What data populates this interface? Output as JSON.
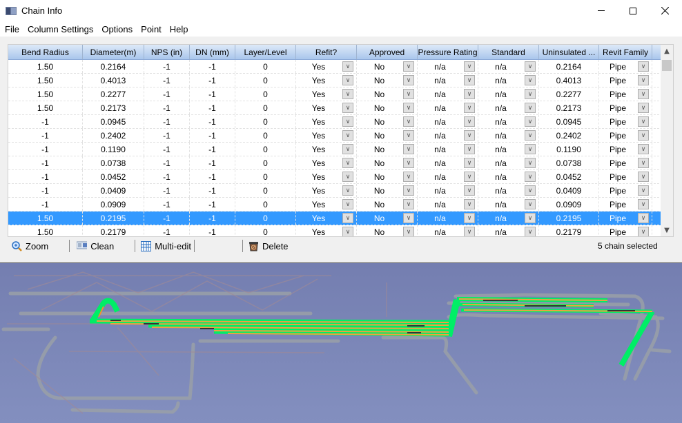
{
  "window": {
    "title": "Chain Info",
    "icon": "app-icon",
    "controls": [
      "minimize-icon",
      "maximize-icon",
      "close-icon"
    ]
  },
  "menu": [
    "File",
    "Column Settings",
    "Options",
    "Point",
    "Help"
  ],
  "table": {
    "columns": [
      "Bend Radius",
      "Diameter(m)",
      "NPS (in)",
      "DN (mm)",
      "Layer/Level",
      "Refit?",
      "Approved",
      "Pressure Rating",
      "Standard",
      "Uninsulated ...",
      "Revit Family"
    ],
    "rows": [
      [
        "1.50",
        "0.2164",
        "-1",
        "-1",
        "0",
        "Yes",
        "No",
        "n/a",
        "n/a",
        "0.2164",
        "Pipe"
      ],
      [
        "1.50",
        "0.4013",
        "-1",
        "-1",
        "0",
        "Yes",
        "No",
        "n/a",
        "n/a",
        "0.4013",
        "Pipe"
      ],
      [
        "1.50",
        "0.2277",
        "-1",
        "-1",
        "0",
        "Yes",
        "No",
        "n/a",
        "n/a",
        "0.2277",
        "Pipe"
      ],
      [
        "1.50",
        "0.2173",
        "-1",
        "-1",
        "0",
        "Yes",
        "No",
        "n/a",
        "n/a",
        "0.2173",
        "Pipe"
      ],
      [
        "-1",
        "0.0945",
        "-1",
        "-1",
        "0",
        "Yes",
        "No",
        "n/a",
        "n/a",
        "0.0945",
        "Pipe"
      ],
      [
        "-1",
        "0.2402",
        "-1",
        "-1",
        "0",
        "Yes",
        "No",
        "n/a",
        "n/a",
        "0.2402",
        "Pipe"
      ],
      [
        "-1",
        "0.1190",
        "-1",
        "-1",
        "0",
        "Yes",
        "No",
        "n/a",
        "n/a",
        "0.1190",
        "Pipe"
      ],
      [
        "-1",
        "0.0738",
        "-1",
        "-1",
        "0",
        "Yes",
        "No",
        "n/a",
        "n/a",
        "0.0738",
        "Pipe"
      ],
      [
        "-1",
        "0.0452",
        "-1",
        "-1",
        "0",
        "Yes",
        "No",
        "n/a",
        "n/a",
        "0.0452",
        "Pipe"
      ],
      [
        "-1",
        "0.0409",
        "-1",
        "-1",
        "0",
        "Yes",
        "No",
        "n/a",
        "n/a",
        "0.0409",
        "Pipe"
      ],
      [
        "-1",
        "0.0909",
        "-1",
        "-1",
        "0",
        "Yes",
        "No",
        "n/a",
        "n/a",
        "0.0909",
        "Pipe"
      ],
      [
        "1.50",
        "0.2195",
        "-1",
        "-1",
        "0",
        "Yes",
        "No",
        "n/a",
        "n/a",
        "0.2195",
        "Pipe"
      ],
      [
        "1.50",
        "0.2179",
        "-1",
        "-1",
        "0",
        "Yes",
        "No",
        "n/a",
        "n/a",
        "0.2179",
        "Pipe"
      ]
    ],
    "combo_columns": [
      5,
      6,
      7,
      8,
      10
    ],
    "selected_row": 11,
    "selection_color": "#3399ff"
  },
  "toolbar": {
    "zoom_label": "Zoom",
    "clean_label": "Clean",
    "multiedit_label": "Multi-edit",
    "delete_label": "Delete"
  },
  "status": "5 chain selected",
  "viewport": {
    "description": "3D pipe model view with selected chains highlighted",
    "highlight_color": "#00ff66",
    "pipe_color": "#f0a040",
    "background_color": "#7f89b8"
  }
}
